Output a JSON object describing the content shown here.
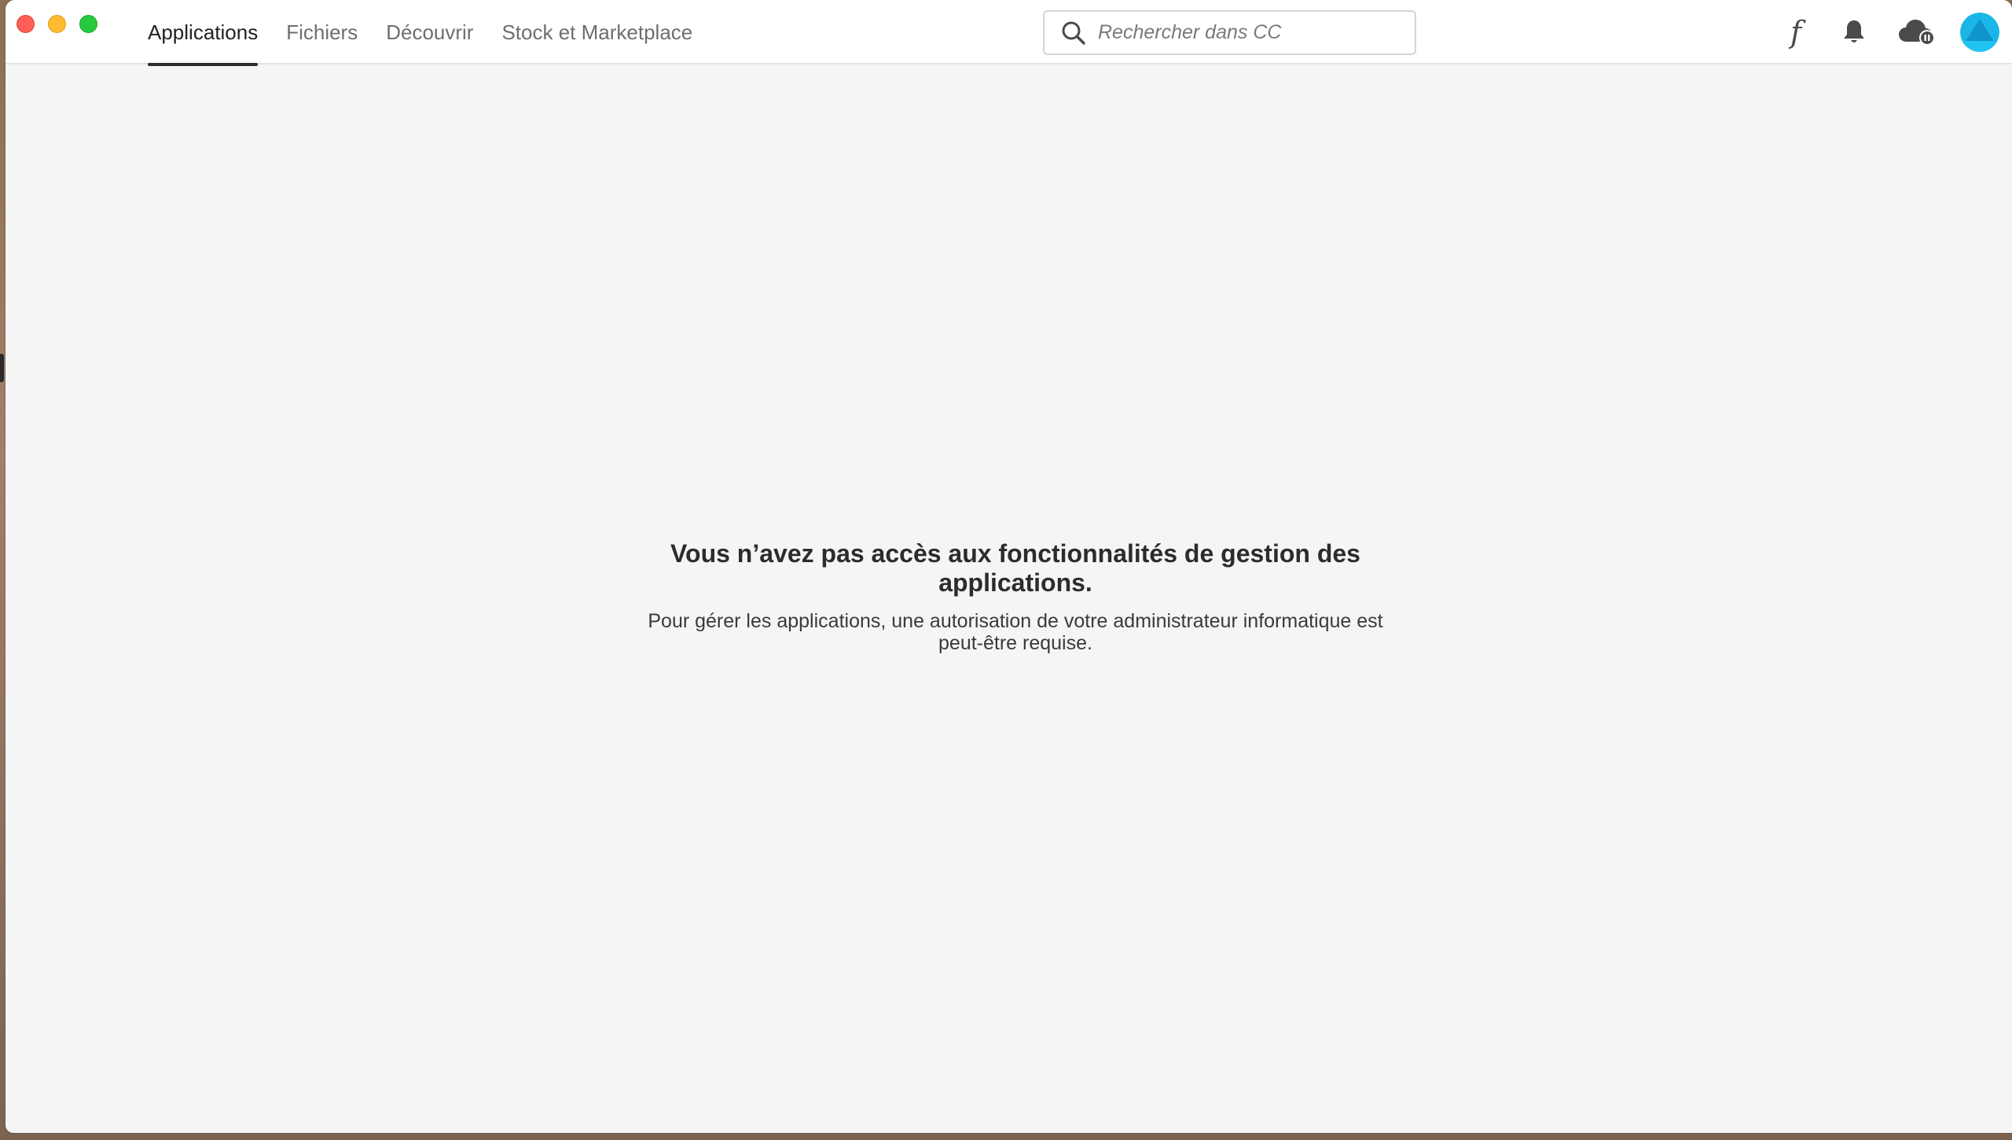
{
  "window": {
    "controls": {
      "close": "close-icon",
      "minimize": "minimize-icon",
      "zoom": "zoom-icon"
    }
  },
  "nav": {
    "tabs": [
      {
        "label": "Applications",
        "active": true
      },
      {
        "label": "Fichiers",
        "active": false
      },
      {
        "label": "Découvrir",
        "active": false
      },
      {
        "label": "Stock et Marketplace",
        "active": false
      }
    ]
  },
  "search": {
    "placeholder": "Rechercher dans CC",
    "value": "",
    "icon": "search-icon"
  },
  "toolbar": {
    "fonts_glyph": "f",
    "icons": [
      "fonts-icon",
      "bell-icon",
      "cloud-sync-icon",
      "avatar"
    ]
  },
  "message": {
    "title": "Vous n’avez pas accès aux fonctionnalités de gestion des applications.",
    "body": "Pour gérer les applications, une autorisation de votre administrateur informatique est peut-être requise."
  },
  "colors": {
    "background": "#f5f5f5",
    "titlebar": "#ffffff",
    "accent_avatar": "#1bb6e8",
    "active_tab_underline": "#2c2c2c"
  }
}
